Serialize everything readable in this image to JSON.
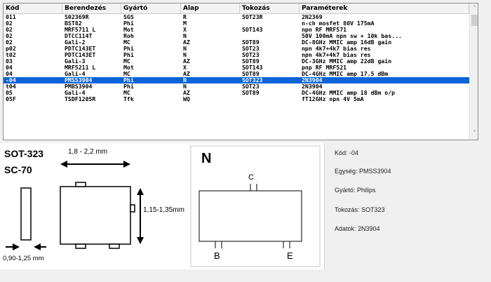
{
  "table": {
    "columns": [
      "Kód",
      "Berendezés",
      "Gyártó",
      "Alap",
      "Tokozás",
      "Paraméterek"
    ],
    "rows": [
      [
        "011",
        "S02369R",
        "SGS",
        "R",
        "SOT23R",
        "2N2369"
      ],
      [
        "02",
        "BST82",
        "Phi",
        "M",
        "",
        "n-ch mosfet 80V 175mA"
      ],
      [
        "02",
        "MRF5711 L",
        "Mot",
        "X",
        "SOT143",
        "npn RF MRF571"
      ],
      [
        "02",
        "DTCC114T",
        "Roh",
        "N",
        "",
        "50V 100mA npn sw + 10k bas..."
      ],
      [
        "02",
        "Gali-2",
        "MC",
        "AZ",
        "SOT89",
        "DC-8GHz MMIC amp 16dB gain"
      ],
      [
        "p02",
        "PDTC143ET",
        "Phi",
        "N",
        "SOT23",
        "npn 4k7+4k7 bias res"
      ],
      [
        "t02",
        "PDTC143ET",
        "Phi",
        "N",
        "SOT23",
        "npn 4k7+4k7 bias res"
      ],
      [
        "03",
        "Gali-3",
        "MC",
        "AZ",
        "SOT89",
        "DC-3GHz MMIC amp 22dB gain"
      ],
      [
        "04",
        "MRF5211 L",
        "Mot",
        "X",
        "SOT143",
        "pnp RF MRF521"
      ],
      [
        "04",
        "Gali-4",
        "MC",
        "AZ",
        "SOT89",
        "DC-4GHz MMIC amp 17.5 dBm"
      ],
      [
        "-04",
        "PMSS3904",
        "Phi",
        "N",
        "SOT323",
        "2N3904"
      ],
      [
        "t04",
        "PMBS3904",
        "Phi",
        "N",
        "SOT23",
        "2N3904"
      ],
      [
        "05",
        "Gali-4",
        "MC",
        "AZ",
        "SOT89",
        "DC-4GHz MMIC amp 18 dBm o/p"
      ],
      [
        "05F",
        "TSDF1205R",
        "Tfk",
        "WQ",
        "",
        "fT12GHz npn 4V 5mA"
      ]
    ],
    "selected_index": 10
  },
  "scrollbar": {
    "up_icon": "chevron-up-icon",
    "down_icon": "chevron-down-icon",
    "up_glyph": "˄",
    "down_glyph": "˅"
  },
  "drawing": {
    "package_name": "SOT-323",
    "package_alt": "SC-70",
    "width_dim": "1,8 - 2,2 mm",
    "height_dim": "1,15-1,35mm",
    "thickness_dim": "0,90-1,25 mm",
    "pinout_letter": "N",
    "pin_top": "C",
    "pin_left": "B",
    "pin_right": "E"
  },
  "details": {
    "kod": "Kód: -04",
    "egyseg": "Egység: PMSS3904",
    "gyarto": "Gyártó: Philips",
    "tokozas": "Tokozás: SOT323",
    "adatok": "Adatok: 2N3904"
  },
  "colors": {
    "selection": "#0a64d8",
    "window_bg": "#f0f0f0"
  }
}
